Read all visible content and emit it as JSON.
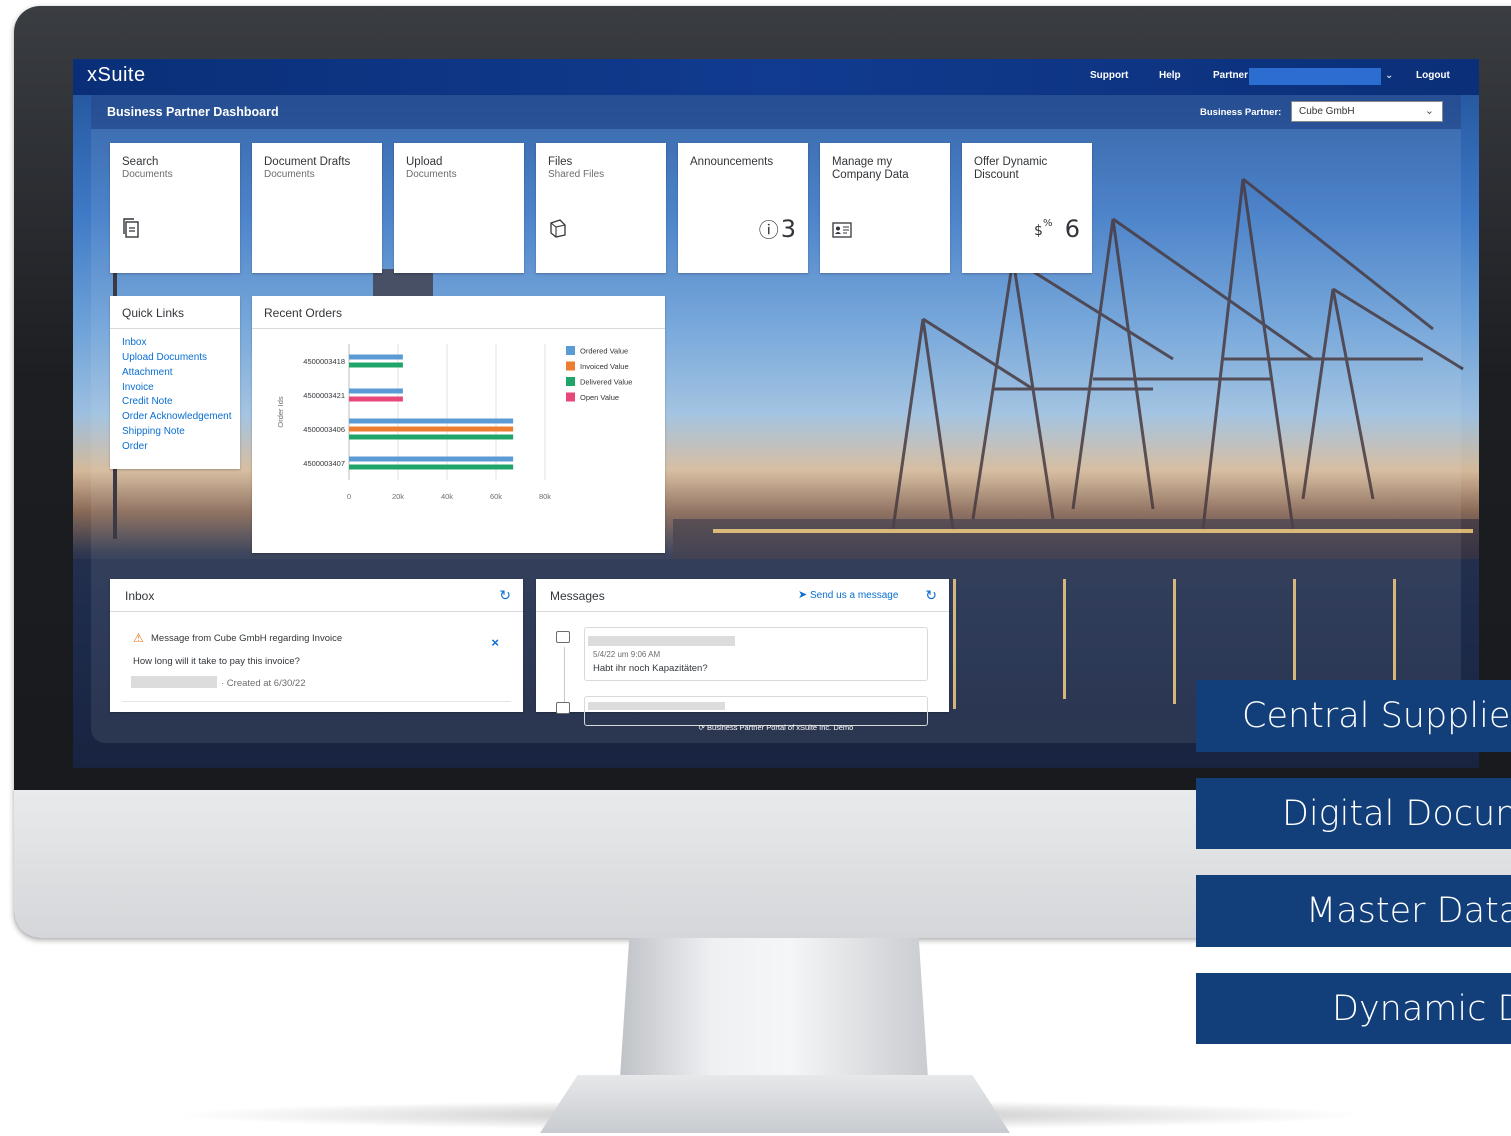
{
  "shell": {
    "logo": "xSuite",
    "links": [
      "Support",
      "Help",
      "Partner",
      "Logout"
    ]
  },
  "header": {
    "title": "Business Partner Dashboard",
    "business_partner_label": "Business Partner:",
    "business_partner_value": "Cube GmbH"
  },
  "tiles": [
    {
      "title": "Search",
      "subtitle": "Documents",
      "icon": "documents-icon",
      "count": ""
    },
    {
      "title": "Document Drafts",
      "subtitle": "Documents",
      "icon": "",
      "count": ""
    },
    {
      "title": "Upload",
      "subtitle": "Documents",
      "icon": "",
      "count": ""
    },
    {
      "title": "Files",
      "subtitle": "Shared Files",
      "icon": "shared-files-icon",
      "count": ""
    },
    {
      "title": "Announcements",
      "subtitle": "",
      "icon": "info-icon",
      "count": "3"
    },
    {
      "title": "Manage my Company Data",
      "subtitle": "",
      "icon": "id-card-icon",
      "count": ""
    },
    {
      "title": "Offer Dynamic Discount",
      "subtitle": "",
      "icon": "discount-money-icon",
      "count": "6"
    }
  ],
  "quick_links": {
    "title": "Quick Links",
    "items": [
      "Inbox",
      "Upload Documents",
      "Attachment",
      "Invoice",
      "Credit Note",
      "Order Acknowledgement",
      "Shipping Note",
      "Order"
    ]
  },
  "recent_orders": {
    "title": "Recent Orders"
  },
  "chart_data": {
    "type": "bar",
    "orientation": "horizontal",
    "categories": [
      "4500003418",
      "4500003421",
      "4500003406",
      "4500003407"
    ],
    "ylabel": "Order Ids",
    "xlabel": "",
    "x_ticks": [
      "0",
      "20k",
      "40k",
      "60k",
      "80k"
    ],
    "xlim": [
      0,
      80000
    ],
    "grid": true,
    "legend_position": "right",
    "series": [
      {
        "name": "Ordered Value",
        "color": "#5b9bd5",
        "values": [
          22000,
          22000,
          67000,
          67000
        ]
      },
      {
        "name": "Invoiced Value",
        "color": "#ed7d31",
        "values": [
          0,
          0,
          67000,
          0
        ]
      },
      {
        "name": "Delivered Value",
        "color": "#1fa56a",
        "values": [
          22000,
          0,
          67000,
          67000
        ]
      },
      {
        "name": "Open Value",
        "color": "#e8477a",
        "values": [
          0,
          22000,
          0,
          0
        ]
      }
    ]
  },
  "inbox": {
    "title": "Inbox",
    "message_title": "Message from Cube GmbH regarding Invoice",
    "message_body": "How long will it take to pay this invoice?",
    "created": "· Created at 6/30/22"
  },
  "messages": {
    "title": "Messages",
    "send_label": "Send us a message",
    "timestamp": "5/4/22 um 9:06 AM",
    "text": "Habt ihr noch Kapazitäten?"
  },
  "footer": "Business Partner Portal of xSuite Inc. Demo",
  "promo_bars": [
    "Central Supplier C",
    "Digital Docume",
    "Master Data S",
    "Dynamic Di"
  ],
  "colors": {
    "shell": "#0a2f78",
    "link": "#0a6ed1",
    "promo": "#123f7a"
  }
}
